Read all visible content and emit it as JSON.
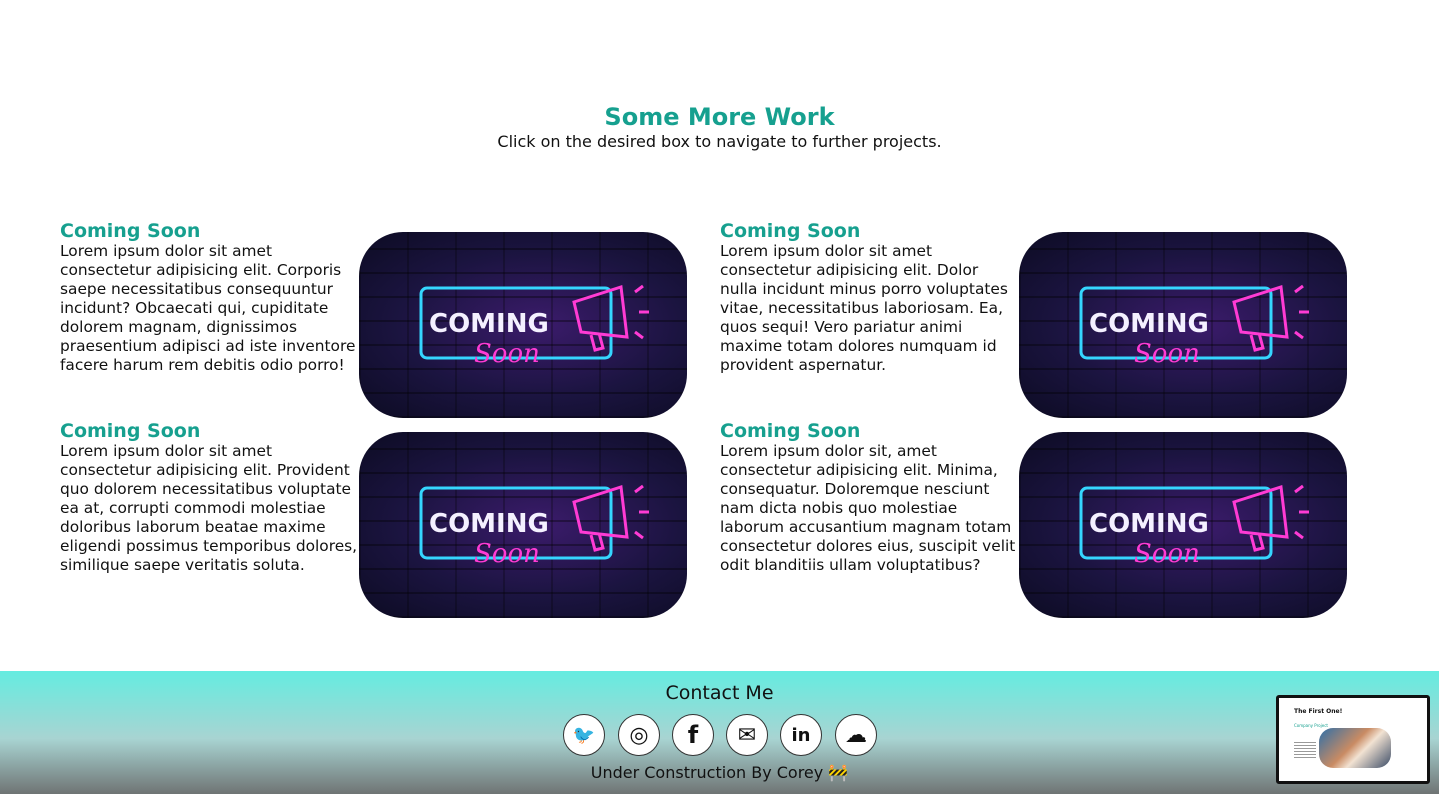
{
  "section": {
    "title": "Some More Work",
    "subtitle": "Click on the desired box to navigate to further projects."
  },
  "projects": [
    {
      "title": "Coming Soon",
      "description": "Lorem ipsum dolor sit amet consectetur adipisicing elit. Corporis saepe necessitatibus consequuntur incidunt? Obcaecati qui, cupiditate dolorem magnam, dignissimos praesentium adipisci ad iste inventore facere harum rem debitis odio porro!",
      "image_text_top": "COMING",
      "image_text_bottom": "Soon"
    },
    {
      "title": "Coming Soon",
      "description": "Lorem ipsum dolor sit amet consectetur adipisicing elit. Dolor nulla incidunt minus porro voluptates vitae, necessitatibus laboriosam. Ea, quos sequi! Vero pariatur animi maxime totam dolores numquam id provident aspernatur.",
      "image_text_top": "COMING",
      "image_text_bottom": "Soon"
    },
    {
      "title": "Coming Soon",
      "description": "Lorem ipsum dolor sit amet consectetur adipisicing elit. Provident quo dolorem necessitatibus voluptate ea at, corrupti commodi molestiae doloribus laborum beatae maxime eligendi possimus temporibus dolores, similique saepe veritatis soluta.",
      "image_text_top": "COMING",
      "image_text_bottom": "Soon"
    },
    {
      "title": "Coming Soon",
      "description": "Lorem ipsum dolor sit, amet consectetur adipisicing elit. Minima, consequatur. Doloremque nesciunt nam dicta nobis quo molestiae laborum accusantium magnam totam consectetur dolores eius, suscipit velit odit blanditiis ullam voluptatibus?",
      "image_text_top": "COMING",
      "image_text_bottom": "Soon"
    }
  ],
  "footer": {
    "heading": "Contact Me",
    "credit": "Under Construction By Corey 🚧",
    "socials": [
      {
        "icon": "twitter-icon",
        "glyph": "🐦"
      },
      {
        "icon": "instagram-icon",
        "glyph": "◎"
      },
      {
        "icon": "facebook-icon",
        "glyph": "f"
      },
      {
        "icon": "email-icon",
        "glyph": "✉"
      },
      {
        "icon": "linkedin-icon",
        "glyph": "in"
      },
      {
        "icon": "soundcloud-icon",
        "glyph": "☁"
      }
    ]
  },
  "preview": {
    "title": "The First One!",
    "subtitle": "Company Project"
  },
  "colors": {
    "accent": "#16a08f",
    "neon_blue": "#35d6ff",
    "neon_pink": "#ff3bd4"
  }
}
